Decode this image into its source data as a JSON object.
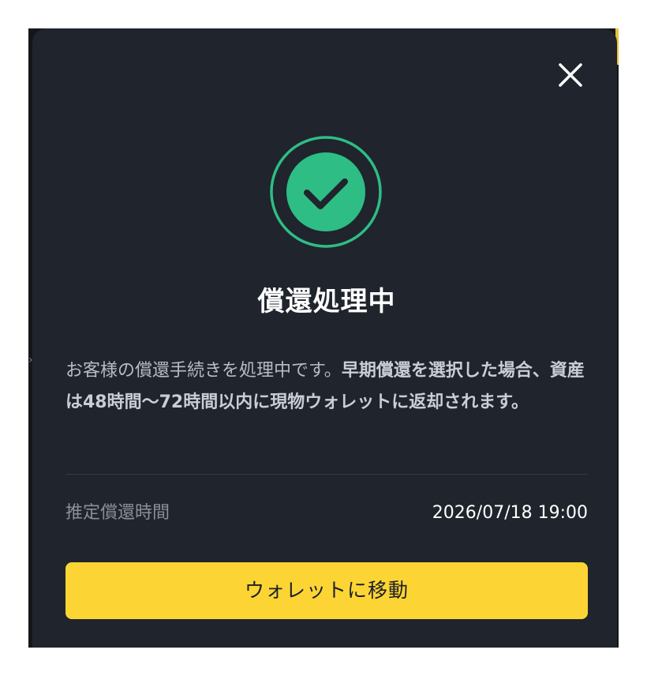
{
  "modal": {
    "title": "償還処理中",
    "description_regular": "お客様の償還手続きを処理中です。",
    "description_bold": "早期償還を選択した場合、資産は48時間〜72時間以内に現物ウォレットに返却されます。",
    "estimated_label": "推定償還時間",
    "estimated_value": "2026/07/18 19:00",
    "button_label": "ウォレットに移動"
  },
  "icons": {
    "close": "close-icon",
    "status": "check-circle-icon"
  },
  "colors": {
    "modal_bg": "#1f242d",
    "accent_green": "#2ebd85",
    "button_yellow": "#fcd535",
    "button_text": "#1e2026"
  }
}
